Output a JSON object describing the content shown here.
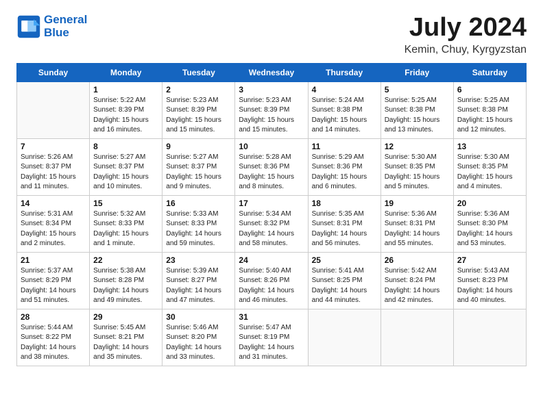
{
  "logo": {
    "line1": "General",
    "line2": "Blue"
  },
  "title": "July 2024",
  "subtitle": "Kemin, Chuy, Kyrgyzstan",
  "days_of_week": [
    "Sunday",
    "Monday",
    "Tuesday",
    "Wednesday",
    "Thursday",
    "Friday",
    "Saturday"
  ],
  "weeks": [
    [
      {
        "num": "",
        "info": ""
      },
      {
        "num": "1",
        "info": "Sunrise: 5:22 AM\nSunset: 8:39 PM\nDaylight: 15 hours\nand 16 minutes."
      },
      {
        "num": "2",
        "info": "Sunrise: 5:23 AM\nSunset: 8:39 PM\nDaylight: 15 hours\nand 15 minutes."
      },
      {
        "num": "3",
        "info": "Sunrise: 5:23 AM\nSunset: 8:39 PM\nDaylight: 15 hours\nand 15 minutes."
      },
      {
        "num": "4",
        "info": "Sunrise: 5:24 AM\nSunset: 8:38 PM\nDaylight: 15 hours\nand 14 minutes."
      },
      {
        "num": "5",
        "info": "Sunrise: 5:25 AM\nSunset: 8:38 PM\nDaylight: 15 hours\nand 13 minutes."
      },
      {
        "num": "6",
        "info": "Sunrise: 5:25 AM\nSunset: 8:38 PM\nDaylight: 15 hours\nand 12 minutes."
      }
    ],
    [
      {
        "num": "7",
        "info": "Sunrise: 5:26 AM\nSunset: 8:37 PM\nDaylight: 15 hours\nand 11 minutes."
      },
      {
        "num": "8",
        "info": "Sunrise: 5:27 AM\nSunset: 8:37 PM\nDaylight: 15 hours\nand 10 minutes."
      },
      {
        "num": "9",
        "info": "Sunrise: 5:27 AM\nSunset: 8:37 PM\nDaylight: 15 hours\nand 9 minutes."
      },
      {
        "num": "10",
        "info": "Sunrise: 5:28 AM\nSunset: 8:36 PM\nDaylight: 15 hours\nand 8 minutes."
      },
      {
        "num": "11",
        "info": "Sunrise: 5:29 AM\nSunset: 8:36 PM\nDaylight: 15 hours\nand 6 minutes."
      },
      {
        "num": "12",
        "info": "Sunrise: 5:30 AM\nSunset: 8:35 PM\nDaylight: 15 hours\nand 5 minutes."
      },
      {
        "num": "13",
        "info": "Sunrise: 5:30 AM\nSunset: 8:35 PM\nDaylight: 15 hours\nand 4 minutes."
      }
    ],
    [
      {
        "num": "14",
        "info": "Sunrise: 5:31 AM\nSunset: 8:34 PM\nDaylight: 15 hours\nand 2 minutes."
      },
      {
        "num": "15",
        "info": "Sunrise: 5:32 AM\nSunset: 8:33 PM\nDaylight: 15 hours\nand 1 minute."
      },
      {
        "num": "16",
        "info": "Sunrise: 5:33 AM\nSunset: 8:33 PM\nDaylight: 14 hours\nand 59 minutes."
      },
      {
        "num": "17",
        "info": "Sunrise: 5:34 AM\nSunset: 8:32 PM\nDaylight: 14 hours\nand 58 minutes."
      },
      {
        "num": "18",
        "info": "Sunrise: 5:35 AM\nSunset: 8:31 PM\nDaylight: 14 hours\nand 56 minutes."
      },
      {
        "num": "19",
        "info": "Sunrise: 5:36 AM\nSunset: 8:31 PM\nDaylight: 14 hours\nand 55 minutes."
      },
      {
        "num": "20",
        "info": "Sunrise: 5:36 AM\nSunset: 8:30 PM\nDaylight: 14 hours\nand 53 minutes."
      }
    ],
    [
      {
        "num": "21",
        "info": "Sunrise: 5:37 AM\nSunset: 8:29 PM\nDaylight: 14 hours\nand 51 minutes."
      },
      {
        "num": "22",
        "info": "Sunrise: 5:38 AM\nSunset: 8:28 PM\nDaylight: 14 hours\nand 49 minutes."
      },
      {
        "num": "23",
        "info": "Sunrise: 5:39 AM\nSunset: 8:27 PM\nDaylight: 14 hours\nand 47 minutes."
      },
      {
        "num": "24",
        "info": "Sunrise: 5:40 AM\nSunset: 8:26 PM\nDaylight: 14 hours\nand 46 minutes."
      },
      {
        "num": "25",
        "info": "Sunrise: 5:41 AM\nSunset: 8:25 PM\nDaylight: 14 hours\nand 44 minutes."
      },
      {
        "num": "26",
        "info": "Sunrise: 5:42 AM\nSunset: 8:24 PM\nDaylight: 14 hours\nand 42 minutes."
      },
      {
        "num": "27",
        "info": "Sunrise: 5:43 AM\nSunset: 8:23 PM\nDaylight: 14 hours\nand 40 minutes."
      }
    ],
    [
      {
        "num": "28",
        "info": "Sunrise: 5:44 AM\nSunset: 8:22 PM\nDaylight: 14 hours\nand 38 minutes."
      },
      {
        "num": "29",
        "info": "Sunrise: 5:45 AM\nSunset: 8:21 PM\nDaylight: 14 hours\nand 35 minutes."
      },
      {
        "num": "30",
        "info": "Sunrise: 5:46 AM\nSunset: 8:20 PM\nDaylight: 14 hours\nand 33 minutes."
      },
      {
        "num": "31",
        "info": "Sunrise: 5:47 AM\nSunset: 8:19 PM\nDaylight: 14 hours\nand 31 minutes."
      },
      {
        "num": "",
        "info": ""
      },
      {
        "num": "",
        "info": ""
      },
      {
        "num": "",
        "info": ""
      }
    ]
  ]
}
